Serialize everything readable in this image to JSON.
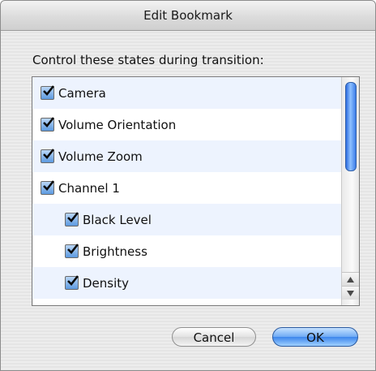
{
  "dialog": {
    "title": "Edit Bookmark",
    "prompt": "Control these states during transition:"
  },
  "list": {
    "items": [
      {
        "label": "Camera",
        "checked": true,
        "level": 0
      },
      {
        "label": "Volume Orientation",
        "checked": true,
        "level": 0
      },
      {
        "label": "Volume Zoom",
        "checked": true,
        "level": 0
      },
      {
        "label": "Channel 1",
        "checked": true,
        "level": 0
      },
      {
        "label": "Black Level",
        "checked": true,
        "level": 1
      },
      {
        "label": "Brightness",
        "checked": true,
        "level": 1
      },
      {
        "label": "Density",
        "checked": true,
        "level": 1
      }
    ]
  },
  "buttons": {
    "cancel": "Cancel",
    "ok": "OK"
  },
  "colors": {
    "row_stripe": "#edf3fe",
    "accent": "#3d86ec"
  },
  "icons": {
    "checkbox": "checkmark-icon",
    "scroll_up": "arrow-up-icon",
    "scroll_down": "arrow-down-icon"
  }
}
